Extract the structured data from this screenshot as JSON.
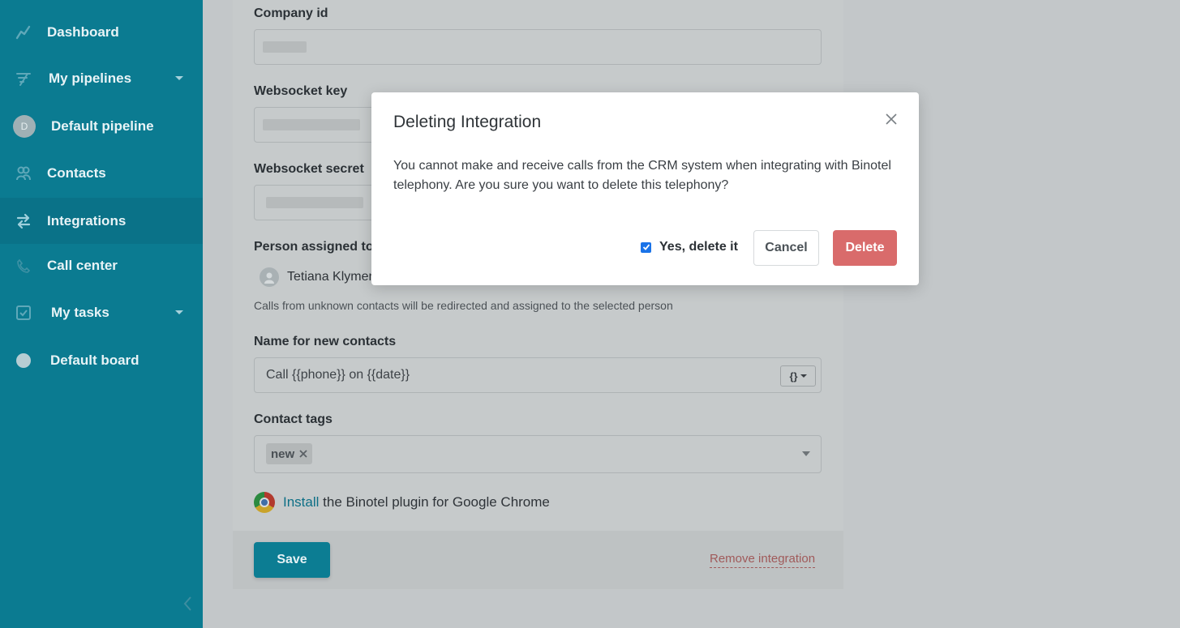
{
  "sidebar": {
    "items": [
      {
        "label": "Dashboard",
        "icon": "chart-line-icon"
      },
      {
        "label": "My pipelines",
        "icon": "funnel-icon"
      },
      {
        "label": "Default pipeline",
        "icon": "avatar-d",
        "avatar_letter": "D"
      },
      {
        "label": "Contacts",
        "icon": "users-icon"
      },
      {
        "label": "Integrations",
        "icon": "arrows-exchange-icon"
      },
      {
        "label": "Call center",
        "icon": "phone-icon"
      },
      {
        "label": "My tasks",
        "icon": "checkbox-icon"
      },
      {
        "label": "Default board",
        "icon": "circle-icon"
      }
    ],
    "active": "Integrations"
  },
  "form": {
    "company_id_label": "Company id",
    "websocket_key_label": "Websocket key",
    "websocket_secret_label": "Websocket secret",
    "person_assigned_label": "Person assigned to",
    "person_name": "Tetiana Klymen",
    "person_helper": "Calls from unknown contacts will be redirected and assigned to the selected person",
    "name_new_contacts_label": "Name for new contacts",
    "name_new_contacts_value": "Call {{phone}} on {{date}}",
    "variables_button": "{}",
    "contact_tags_label": "Contact tags",
    "tags": [
      "new"
    ],
    "plugin_link": "Install",
    "plugin_text": "the Binotel plugin for Google Chrome",
    "save_label": "Save",
    "remove_label": "Remove integration"
  },
  "modal": {
    "title": "Deleting Integration",
    "body": "You cannot make and receive calls from the CRM system when integrating with Binotel telephony. Are you sure you want to delete this telephony?",
    "confirm_label": "Yes, delete it",
    "confirm_checked": true,
    "cancel_label": "Cancel",
    "delete_label": "Delete"
  },
  "colors": {
    "sidebar": "#0b7b91",
    "primary": "#0c7d93",
    "danger": "#d96b6b"
  }
}
